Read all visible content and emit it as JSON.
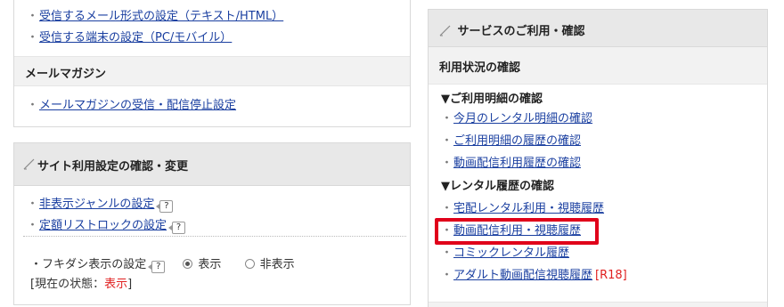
{
  "left_top": {
    "links": [
      "受信するメール形式の設定（テキスト/HTML）",
      "受信する端末の設定（PC/モバイル）"
    ],
    "magazine_header": "メールマガジン",
    "magazine_link": "メールマガジンの受信・配信停止設定"
  },
  "site_settings": {
    "header": "サイト利用設定の確認・変更",
    "links": [
      "非表示ジャンルの設定",
      "定額リストロックの設定"
    ],
    "help_label": "?",
    "fukidashi_label": "・フキダシ表示の設定",
    "radio_show": "表示",
    "radio_hide": "非表示",
    "status_prefix": "[現在の状態：",
    "status_value": "表示",
    "status_suffix": "]"
  },
  "services": {
    "header": "サービスのご利用・確認",
    "subheader": "利用状況の確認",
    "section1": "▼ご利用明細の確認",
    "section1_links": [
      "今月のレンタル明細の確認",
      "ご利用明細の履歴の確認",
      "動画配信利用履歴の確認"
    ],
    "section2": "▼レンタル履歴の確認",
    "section2_links": [
      "宅配レンタル利用・視聴履歴",
      "動画配信利用・視聴履歴",
      "コミックレンタル履歴",
      "アダルト動画配信視聴履歴"
    ],
    "r18_badge": "[R18]"
  },
  "colors": {
    "link": "#1a3fa0",
    "highlight": "#e0001a",
    "status": "#e02020"
  }
}
